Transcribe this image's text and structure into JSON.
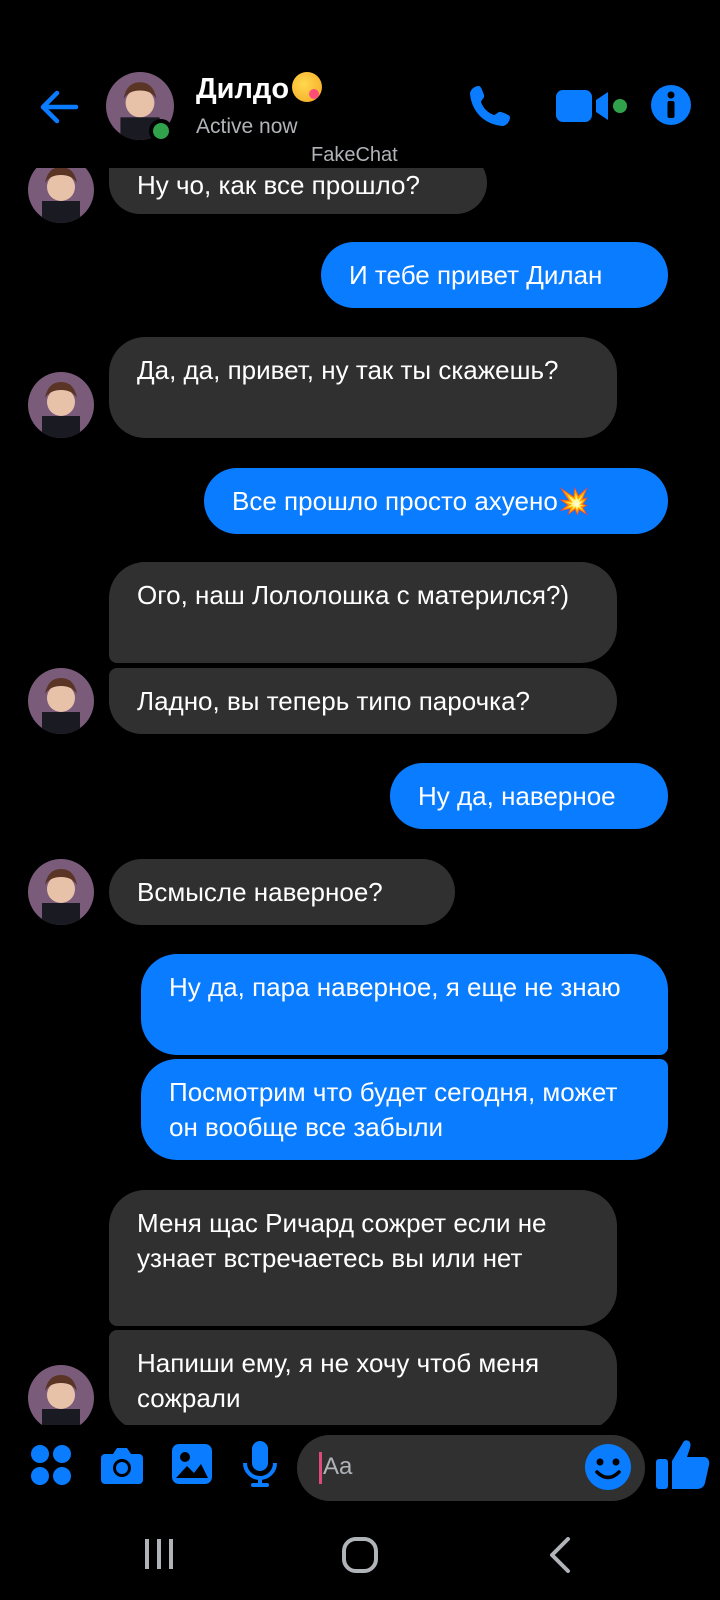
{
  "header": {
    "contact_name": "Дилдо",
    "status": "Active now",
    "watermark": "FakeChat",
    "icons": [
      "back-arrow-icon",
      "phone-icon",
      "video-camera-icon",
      "info-icon"
    ]
  },
  "messages": [
    {
      "side": "in",
      "text": "Ну чо, как все прошло?"
    },
    {
      "side": "out",
      "text": "И тебе привет Дилан"
    },
    {
      "side": "in",
      "text": "Да, да, привет, ну так ты скажешь?"
    },
    {
      "side": "out",
      "text": "Все прошло просто ахуено💥"
    },
    {
      "side": "in",
      "text": "Ого, наш Лололошка с матерился?)"
    },
    {
      "side": "in",
      "text": "Ладно, вы теперь типо парочка?"
    },
    {
      "side": "out",
      "text": "Ну да, наверное"
    },
    {
      "side": "in",
      "text": "Всмысле наверное?"
    },
    {
      "side": "out",
      "text": "Ну да, пара наверное, я еще не знаю"
    },
    {
      "side": "out",
      "text": "Посмотрим что будет сегодня, может он вообще все забыли"
    },
    {
      "side": "in",
      "text": "Меня щас Ричард сожрет если не узнает встречаетесь вы или нет"
    },
    {
      "side": "in",
      "text": "Напиши ему, я не хочу чтоб меня сожрали"
    }
  ],
  "composer": {
    "placeholder": "Aa",
    "icons": [
      "apps-grid-icon",
      "camera-icon",
      "gallery-icon",
      "microphone-icon",
      "emoji-icon",
      "thumbs-up-icon"
    ]
  },
  "colors": {
    "accent": "#0a7cff",
    "incoming_bubble": "#303030",
    "background": "#000000",
    "online": "#31a24c"
  }
}
